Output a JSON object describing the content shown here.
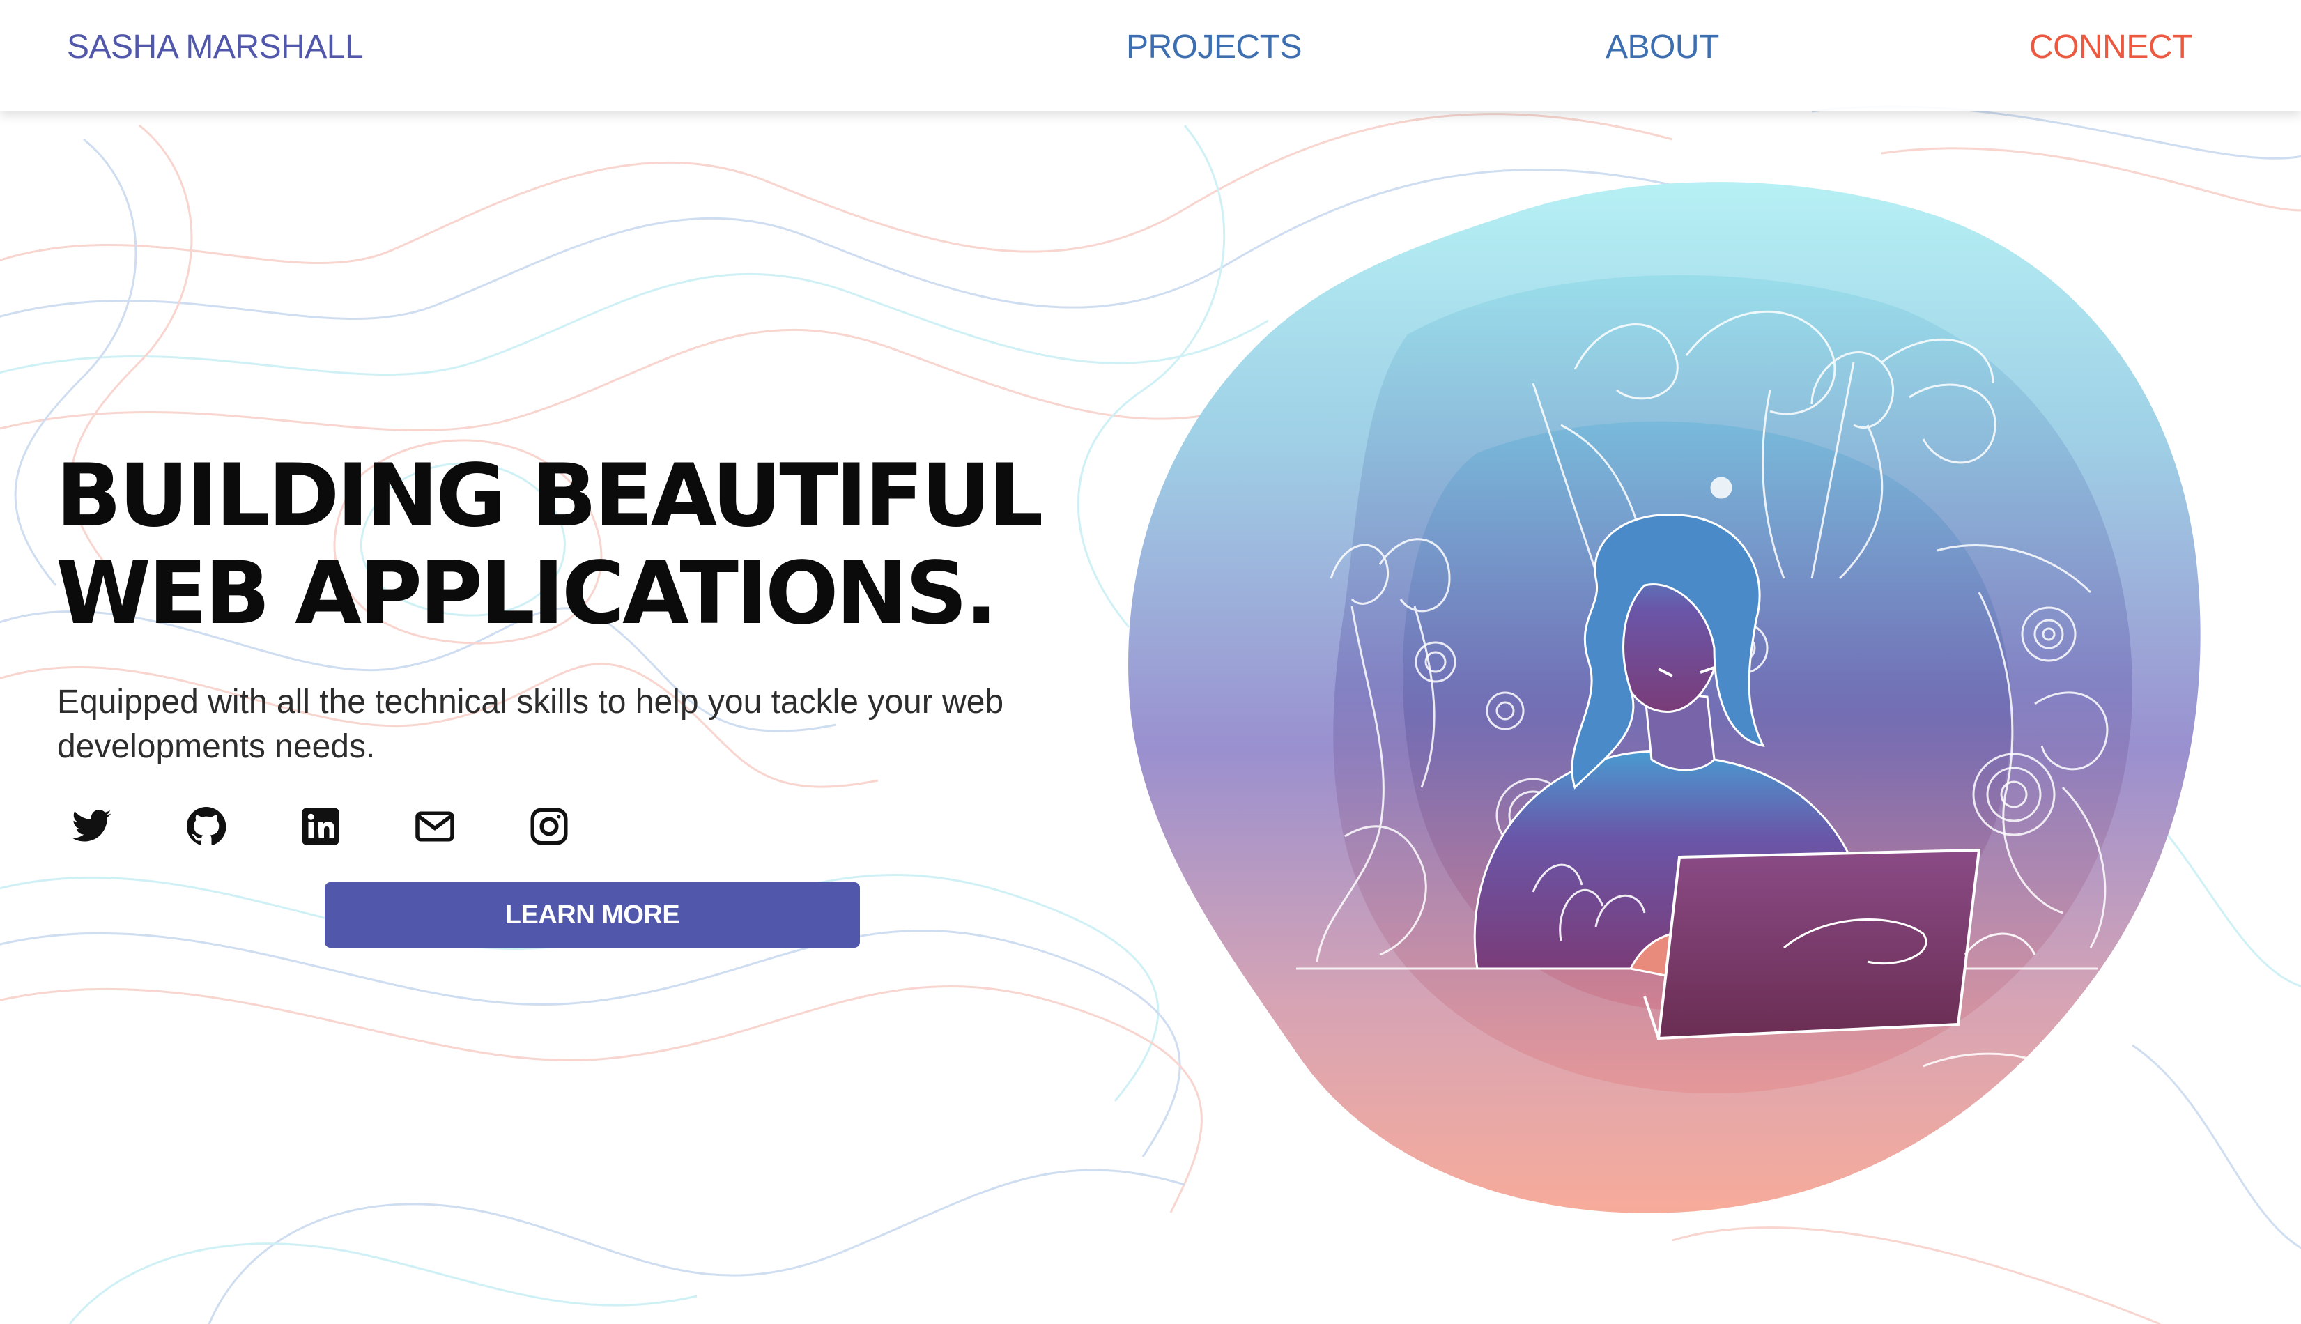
{
  "nav": {
    "brand": "SASHA MARSHALL",
    "links": [
      {
        "label": "PROJECTS"
      },
      {
        "label": "ABOUT"
      },
      {
        "label": "CONNECT"
      }
    ]
  },
  "hero": {
    "title_line1": "BUILDING BEAUTIFUL",
    "title_line2": "WEB APPLICATIONS.",
    "subtitle": "Equipped with all the technical skills to help you tackle your web developments needs.",
    "cta_label": "LEARN MORE"
  },
  "socials": [
    {
      "icon": "twitter-icon"
    },
    {
      "icon": "github-icon"
    },
    {
      "icon": "linkedin-icon"
    },
    {
      "icon": "mail-icon"
    },
    {
      "icon": "instagram-icon"
    }
  ],
  "illustration": {
    "subject": "woman-working-on-laptop",
    "gradient_top": "#b6f0f4",
    "gradient_mid": "#7f78c2",
    "gradient_bottom": "#f3a394"
  },
  "colors": {
    "brand": "#5157ab",
    "nav_link": "#3c6eb0",
    "connect": "#ea5940",
    "button": "#5157ab",
    "contour_red": "#f3b3a8",
    "contour_blue": "#a9c2e6",
    "contour_cyan": "#a8e6ee"
  }
}
